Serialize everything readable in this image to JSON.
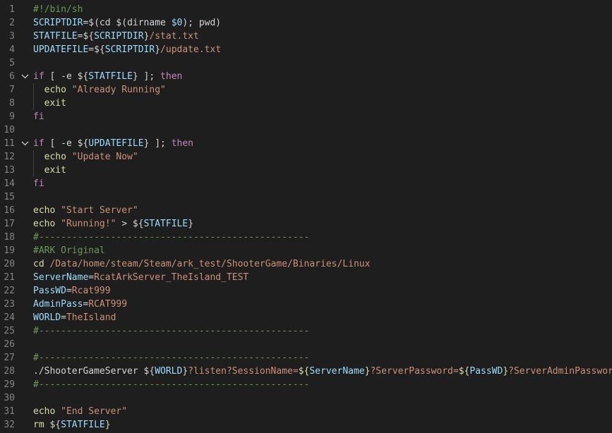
{
  "editor": {
    "language": "shellscript",
    "theme": "dark",
    "colors": {
      "background": "#1e1e1e",
      "line_number": "#858585",
      "default": "#d4d4d4",
      "variable": "#9cdcfe",
      "keyword": "#c586c0",
      "string": "#ce9178",
      "comment": "#6a9955",
      "builtin": "#dcdcaa",
      "operator": "#d4d4d4"
    },
    "lines": [
      {
        "n": "1",
        "tokens": [
          {
            "t": "#!/bin/sh",
            "c": "comment"
          }
        ]
      },
      {
        "n": "2",
        "tokens": [
          {
            "t": "SCRIPTDIR",
            "c": "variable"
          },
          {
            "t": "=$(cd $(dirname ",
            "c": "default"
          },
          {
            "t": "$0",
            "c": "variable"
          },
          {
            "t": "); pwd)",
            "c": "default"
          }
        ]
      },
      {
        "n": "3",
        "tokens": [
          {
            "t": "STATFILE",
            "c": "variable"
          },
          {
            "t": "=${",
            "c": "default"
          },
          {
            "t": "SCRIPTDIR",
            "c": "variable"
          },
          {
            "t": "}",
            "c": "default"
          },
          {
            "t": "/stat.txt",
            "c": "string"
          }
        ]
      },
      {
        "n": "4",
        "tokens": [
          {
            "t": "UPDATEFILE",
            "c": "variable"
          },
          {
            "t": "=${",
            "c": "default"
          },
          {
            "t": "SCRIPTDIR",
            "c": "variable"
          },
          {
            "t": "}",
            "c": "default"
          },
          {
            "t": "/update.txt",
            "c": "string"
          }
        ]
      },
      {
        "n": "5",
        "tokens": []
      },
      {
        "n": "6",
        "fold": true,
        "tokens": [
          {
            "t": "if",
            "c": "keyword"
          },
          {
            "t": " [ -e ${",
            "c": "default"
          },
          {
            "t": "STATFILE",
            "c": "variable"
          },
          {
            "t": "} ]; ",
            "c": "default"
          },
          {
            "t": "then",
            "c": "keyword"
          }
        ]
      },
      {
        "n": "7",
        "indent": true,
        "tokens": [
          {
            "t": "echo ",
            "c": "builtin"
          },
          {
            "t": "\"Already Running\"",
            "c": "string"
          }
        ]
      },
      {
        "n": "8",
        "indent": true,
        "tokens": [
          {
            "t": "exit",
            "c": "builtin"
          }
        ]
      },
      {
        "n": "9",
        "tokens": [
          {
            "t": "fi",
            "c": "keyword"
          }
        ]
      },
      {
        "n": "10",
        "tokens": []
      },
      {
        "n": "11",
        "fold": true,
        "tokens": [
          {
            "t": "if",
            "c": "keyword"
          },
          {
            "t": " [ -e ${",
            "c": "default"
          },
          {
            "t": "UPDATEFILE",
            "c": "variable"
          },
          {
            "t": "} ]; ",
            "c": "default"
          },
          {
            "t": "then",
            "c": "keyword"
          }
        ]
      },
      {
        "n": "12",
        "indent": true,
        "tokens": [
          {
            "t": "echo ",
            "c": "builtin"
          },
          {
            "t": "\"Update Now\"",
            "c": "string"
          }
        ]
      },
      {
        "n": "13",
        "indent": true,
        "tokens": [
          {
            "t": "exit",
            "c": "builtin"
          }
        ]
      },
      {
        "n": "14",
        "tokens": [
          {
            "t": "fi",
            "c": "keyword"
          }
        ]
      },
      {
        "n": "15",
        "tokens": []
      },
      {
        "n": "16",
        "tokens": [
          {
            "t": "echo ",
            "c": "builtin"
          },
          {
            "t": "\"Start Server\"",
            "c": "string"
          }
        ]
      },
      {
        "n": "17",
        "tokens": [
          {
            "t": "echo ",
            "c": "builtin"
          },
          {
            "t": "\"Running!\"",
            "c": "string"
          },
          {
            "t": " > ${",
            "c": "default"
          },
          {
            "t": "STATFILE",
            "c": "variable"
          },
          {
            "t": "}",
            "c": "default"
          }
        ]
      },
      {
        "n": "18",
        "tokens": [
          {
            "t": "#-------------------------------------------------",
            "c": "comment"
          }
        ]
      },
      {
        "n": "19",
        "tokens": [
          {
            "t": "#ARK Original",
            "c": "comment"
          }
        ]
      },
      {
        "n": "20",
        "tokens": [
          {
            "t": "cd ",
            "c": "builtin"
          },
          {
            "t": "/Data/home/steam/Steam/ark_test/ShooterGame/Binaries/Linux",
            "c": "string"
          }
        ]
      },
      {
        "n": "21",
        "tokens": [
          {
            "t": "ServerName",
            "c": "variable"
          },
          {
            "t": "=",
            "c": "default"
          },
          {
            "t": "RcatArkServer_TheIsland_TEST",
            "c": "string"
          }
        ]
      },
      {
        "n": "22",
        "tokens": [
          {
            "t": "PassWD",
            "c": "variable"
          },
          {
            "t": "=",
            "c": "default"
          },
          {
            "t": "Rcat999",
            "c": "string"
          }
        ]
      },
      {
        "n": "23",
        "tokens": [
          {
            "t": "AdminPass",
            "c": "variable"
          },
          {
            "t": "=",
            "c": "default"
          },
          {
            "t": "RCAT999",
            "c": "string"
          }
        ]
      },
      {
        "n": "24",
        "tokens": [
          {
            "t": "WORLD",
            "c": "variable"
          },
          {
            "t": "=",
            "c": "default"
          },
          {
            "t": "TheIsland",
            "c": "string"
          }
        ]
      },
      {
        "n": "25",
        "tokens": [
          {
            "t": "#-------------------------------------------------",
            "c": "comment"
          }
        ]
      },
      {
        "n": "26",
        "tokens": []
      },
      {
        "n": "27",
        "tokens": [
          {
            "t": "#-------------------------------------------------",
            "c": "comment"
          }
        ]
      },
      {
        "n": "28",
        "tokens": [
          {
            "t": "./ShooterGameServer ${",
            "c": "default"
          },
          {
            "t": "WORLD",
            "c": "variable"
          },
          {
            "t": "}",
            "c": "default"
          },
          {
            "t": "?listen?SessionName=",
            "c": "string"
          },
          {
            "t": "${",
            "c": "builtin"
          },
          {
            "t": "ServerName",
            "c": "variable"
          },
          {
            "t": "}",
            "c": "builtin"
          },
          {
            "t": "?ServerPassword=",
            "c": "string"
          },
          {
            "t": "${",
            "c": "builtin"
          },
          {
            "t": "PassWD",
            "c": "variable"
          },
          {
            "t": "}",
            "c": "builtin"
          },
          {
            "t": "?ServerAdminPassword=",
            "c": "string"
          }
        ]
      },
      {
        "n": "29",
        "tokens": [
          {
            "t": "#-------------------------------------------------",
            "c": "comment"
          }
        ]
      },
      {
        "n": "30",
        "tokens": []
      },
      {
        "n": "31",
        "tokens": [
          {
            "t": "echo ",
            "c": "builtin"
          },
          {
            "t": "\"End Server\"",
            "c": "string"
          }
        ]
      },
      {
        "n": "32",
        "tokens": [
          {
            "t": "rm ",
            "c": "builtin"
          },
          {
            "t": "${",
            "c": "default"
          },
          {
            "t": "STATFILE",
            "c": "variable"
          },
          {
            "t": "}",
            "c": "default"
          }
        ]
      }
    ]
  }
}
